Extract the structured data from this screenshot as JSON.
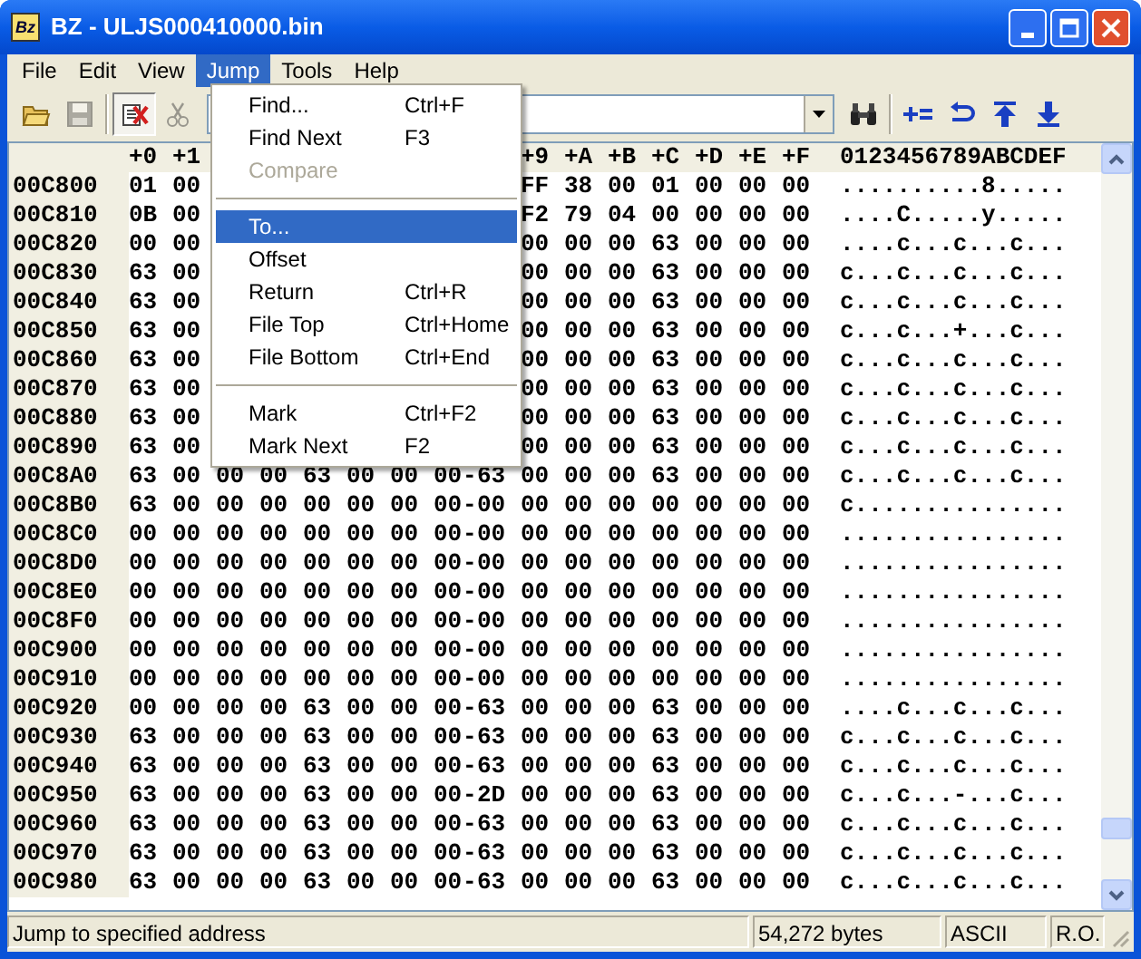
{
  "window": {
    "title": "BZ - ULJS000410000.bin",
    "icon_text": "Bz"
  },
  "menu_bar": [
    {
      "label": "File",
      "selected": false
    },
    {
      "label": "Edit",
      "selected": false
    },
    {
      "label": "View",
      "selected": false
    },
    {
      "label": "Jump",
      "selected": true
    },
    {
      "label": "Tools",
      "selected": false
    },
    {
      "label": "Help",
      "selected": false
    }
  ],
  "toolbar": [
    {
      "kind": "open",
      "disabled": false,
      "pressed": false
    },
    {
      "kind": "save",
      "disabled": true,
      "pressed": false
    },
    {
      "kind": "separator"
    },
    {
      "kind": "mark",
      "disabled": false,
      "pressed": true
    },
    {
      "kind": "cut",
      "disabled": true,
      "pressed": false
    },
    {
      "kind": "combo"
    },
    {
      "kind": "find",
      "disabled": false,
      "pressed": false
    },
    {
      "kind": "separator"
    },
    {
      "kind": "add",
      "disabled": false,
      "pressed": false
    },
    {
      "kind": "return",
      "disabled": false,
      "pressed": false
    },
    {
      "kind": "top",
      "disabled": false,
      "pressed": false
    },
    {
      "kind": "bottom",
      "disabled": false,
      "pressed": false
    }
  ],
  "hex_view": {
    "columns_start": [
      "+0",
      "+1"
    ],
    "columns_end": [
      "+9",
      "+A",
      "+B",
      "+C",
      "+D",
      "+E",
      "+F"
    ],
    "ascii_header": "0123456789ABCDEF",
    "separator": "-",
    "rows": [
      {
        "address": "00C800",
        "bytes_start": [
          "01",
          "00"
        ],
        "bytes_end": [
          "FF",
          "38",
          "00",
          "01",
          "00",
          "00",
          "00"
        ],
        "ascii": "..........8....."
      },
      {
        "address": "00C810",
        "bytes_start": [
          "0B",
          "00"
        ],
        "bytes_end": [
          "F2",
          "79",
          "04",
          "00",
          "00",
          "00",
          "00"
        ],
        "ascii": "....C.....y....."
      },
      {
        "address": "00C820",
        "bytes_start": [
          "00",
          "00"
        ],
        "bytes_end": [
          "00",
          "00",
          "00",
          "63",
          "00",
          "00",
          "00"
        ],
        "ascii": "....c...c...c..."
      },
      {
        "address": "00C830",
        "bytes_start": [
          "63",
          "00"
        ],
        "bytes_end": [
          "00",
          "00",
          "00",
          "63",
          "00",
          "00",
          "00"
        ],
        "ascii": "c...c...c...c..."
      },
      {
        "address": "00C840",
        "bytes_start": [
          "63",
          "00"
        ],
        "bytes_end": [
          "00",
          "00",
          "00",
          "63",
          "00",
          "00",
          "00"
        ],
        "ascii": "c...c...c...c..."
      },
      {
        "address": "00C850",
        "bytes_start": [
          "63",
          "00"
        ],
        "bytes_end": [
          "00",
          "00",
          "00",
          "63",
          "00",
          "00",
          "00"
        ],
        "ascii": "c...c...+...c..."
      },
      {
        "address": "00C860",
        "bytes_start": [
          "63",
          "00"
        ],
        "bytes_end": [
          "00",
          "00",
          "00",
          "63",
          "00",
          "00",
          "00"
        ],
        "ascii": "c...c...c...c..."
      },
      {
        "address": "00C870",
        "bytes_start": [
          "63",
          "00"
        ],
        "bytes_end": [
          "00",
          "00",
          "00",
          "63",
          "00",
          "00",
          "00"
        ],
        "ascii": "c...c...c...c..."
      },
      {
        "address": "00C880",
        "bytes_start": [
          "63",
          "00"
        ],
        "bytes_end": [
          "00",
          "00",
          "00",
          "63",
          "00",
          "00",
          "00"
        ],
        "ascii": "c...c...c...c..."
      },
      {
        "address": "00C890",
        "bytes_start": [
          "63",
          "00"
        ],
        "bytes_end": [
          "00",
          "00",
          "00",
          "63",
          "00",
          "00",
          "00"
        ],
        "ascii": "c...c...c...c..."
      },
      {
        "address": "00C8A0",
        "bytes": [
          "63",
          "00",
          "00",
          "00",
          "63",
          "00",
          "00",
          "00",
          "63",
          "00",
          "00",
          "00",
          "63",
          "00",
          "00",
          "00"
        ],
        "ascii": "c...c...c...c..."
      },
      {
        "address": "00C8B0",
        "bytes": [
          "63",
          "00",
          "00",
          "00",
          "00",
          "00",
          "00",
          "00",
          "00",
          "00",
          "00",
          "00",
          "00",
          "00",
          "00",
          "00"
        ],
        "ascii": "c..............."
      },
      {
        "address": "00C8C0",
        "bytes": [
          "00",
          "00",
          "00",
          "00",
          "00",
          "00",
          "00",
          "00",
          "00",
          "00",
          "00",
          "00",
          "00",
          "00",
          "00",
          "00"
        ],
        "ascii": "................"
      },
      {
        "address": "00C8D0",
        "bytes": [
          "00",
          "00",
          "00",
          "00",
          "00",
          "00",
          "00",
          "00",
          "00",
          "00",
          "00",
          "00",
          "00",
          "00",
          "00",
          "00"
        ],
        "ascii": "................"
      },
      {
        "address": "00C8E0",
        "bytes": [
          "00",
          "00",
          "00",
          "00",
          "00",
          "00",
          "00",
          "00",
          "00",
          "00",
          "00",
          "00",
          "00",
          "00",
          "00",
          "00"
        ],
        "ascii": "................"
      },
      {
        "address": "00C8F0",
        "bytes": [
          "00",
          "00",
          "00",
          "00",
          "00",
          "00",
          "00",
          "00",
          "00",
          "00",
          "00",
          "00",
          "00",
          "00",
          "00",
          "00"
        ],
        "ascii": "................"
      },
      {
        "address": "00C900",
        "bytes": [
          "00",
          "00",
          "00",
          "00",
          "00",
          "00",
          "00",
          "00",
          "00",
          "00",
          "00",
          "00",
          "00",
          "00",
          "00",
          "00"
        ],
        "ascii": "................"
      },
      {
        "address": "00C910",
        "bytes": [
          "00",
          "00",
          "00",
          "00",
          "00",
          "00",
          "00",
          "00",
          "00",
          "00",
          "00",
          "00",
          "00",
          "00",
          "00",
          "00"
        ],
        "ascii": "................"
      },
      {
        "address": "00C920",
        "bytes": [
          "00",
          "00",
          "00",
          "00",
          "63",
          "00",
          "00",
          "00",
          "63",
          "00",
          "00",
          "00",
          "63",
          "00",
          "00",
          "00"
        ],
        "ascii": "....c...c...c..."
      },
      {
        "address": "00C930",
        "bytes": [
          "63",
          "00",
          "00",
          "00",
          "63",
          "00",
          "00",
          "00",
          "63",
          "00",
          "00",
          "00",
          "63",
          "00",
          "00",
          "00"
        ],
        "ascii": "c...c...c...c..."
      },
      {
        "address": "00C940",
        "bytes": [
          "63",
          "00",
          "00",
          "00",
          "63",
          "00",
          "00",
          "00",
          "63",
          "00",
          "00",
          "00",
          "63",
          "00",
          "00",
          "00"
        ],
        "ascii": "c...c...c...c..."
      },
      {
        "address": "00C950",
        "bytes": [
          "63",
          "00",
          "00",
          "00",
          "63",
          "00",
          "00",
          "00",
          "2D",
          "00",
          "00",
          "00",
          "63",
          "00",
          "00",
          "00"
        ],
        "ascii": "c...c...-...c..."
      },
      {
        "address": "00C960",
        "bytes": [
          "63",
          "00",
          "00",
          "00",
          "63",
          "00",
          "00",
          "00",
          "63",
          "00",
          "00",
          "00",
          "63",
          "00",
          "00",
          "00"
        ],
        "ascii": "c...c...c...c..."
      },
      {
        "address": "00C970",
        "bytes": [
          "63",
          "00",
          "00",
          "00",
          "63",
          "00",
          "00",
          "00",
          "63",
          "00",
          "00",
          "00",
          "63",
          "00",
          "00",
          "00"
        ],
        "ascii": "c...c...c...c..."
      },
      {
        "address": "00C980",
        "bytes": [
          "63",
          "00",
          "00",
          "00",
          "63",
          "00",
          "00",
          "00",
          "63",
          "00",
          "00",
          "00",
          "63",
          "00",
          "00",
          "00"
        ],
        "ascii": "c...c...c...c..."
      }
    ]
  },
  "jump_menu": [
    {
      "kind": "item",
      "label": "Find...",
      "shortcut": "Ctrl+F",
      "disabled": false,
      "selected": false
    },
    {
      "kind": "item",
      "label": "Find Next",
      "shortcut": "F3",
      "disabled": false,
      "selected": false
    },
    {
      "kind": "item",
      "label": "Compare",
      "disabled": true,
      "selected": false
    },
    {
      "kind": "separator"
    },
    {
      "kind": "item",
      "label": "To...",
      "disabled": false,
      "selected": true
    },
    {
      "kind": "item",
      "label": "Offset",
      "disabled": false,
      "selected": false
    },
    {
      "kind": "item",
      "label": "Return",
      "shortcut": "Ctrl+R",
      "disabled": false,
      "selected": false
    },
    {
      "kind": "item",
      "label": "File Top",
      "shortcut": "Ctrl+Home",
      "disabled": false,
      "selected": false
    },
    {
      "kind": "item",
      "label": "File Bottom",
      "shortcut": "Ctrl+End",
      "disabled": false,
      "selected": false
    },
    {
      "kind": "separator"
    },
    {
      "kind": "item",
      "label": "Mark",
      "shortcut": "Ctrl+F2",
      "disabled": false,
      "selected": false
    },
    {
      "kind": "item",
      "label": "Mark Next",
      "shortcut": "F2",
      "disabled": false,
      "selected": false
    }
  ],
  "status_bar": [
    "Jump to specified address",
    "54,272 bytes",
    "ASCII",
    "R.O."
  ]
}
